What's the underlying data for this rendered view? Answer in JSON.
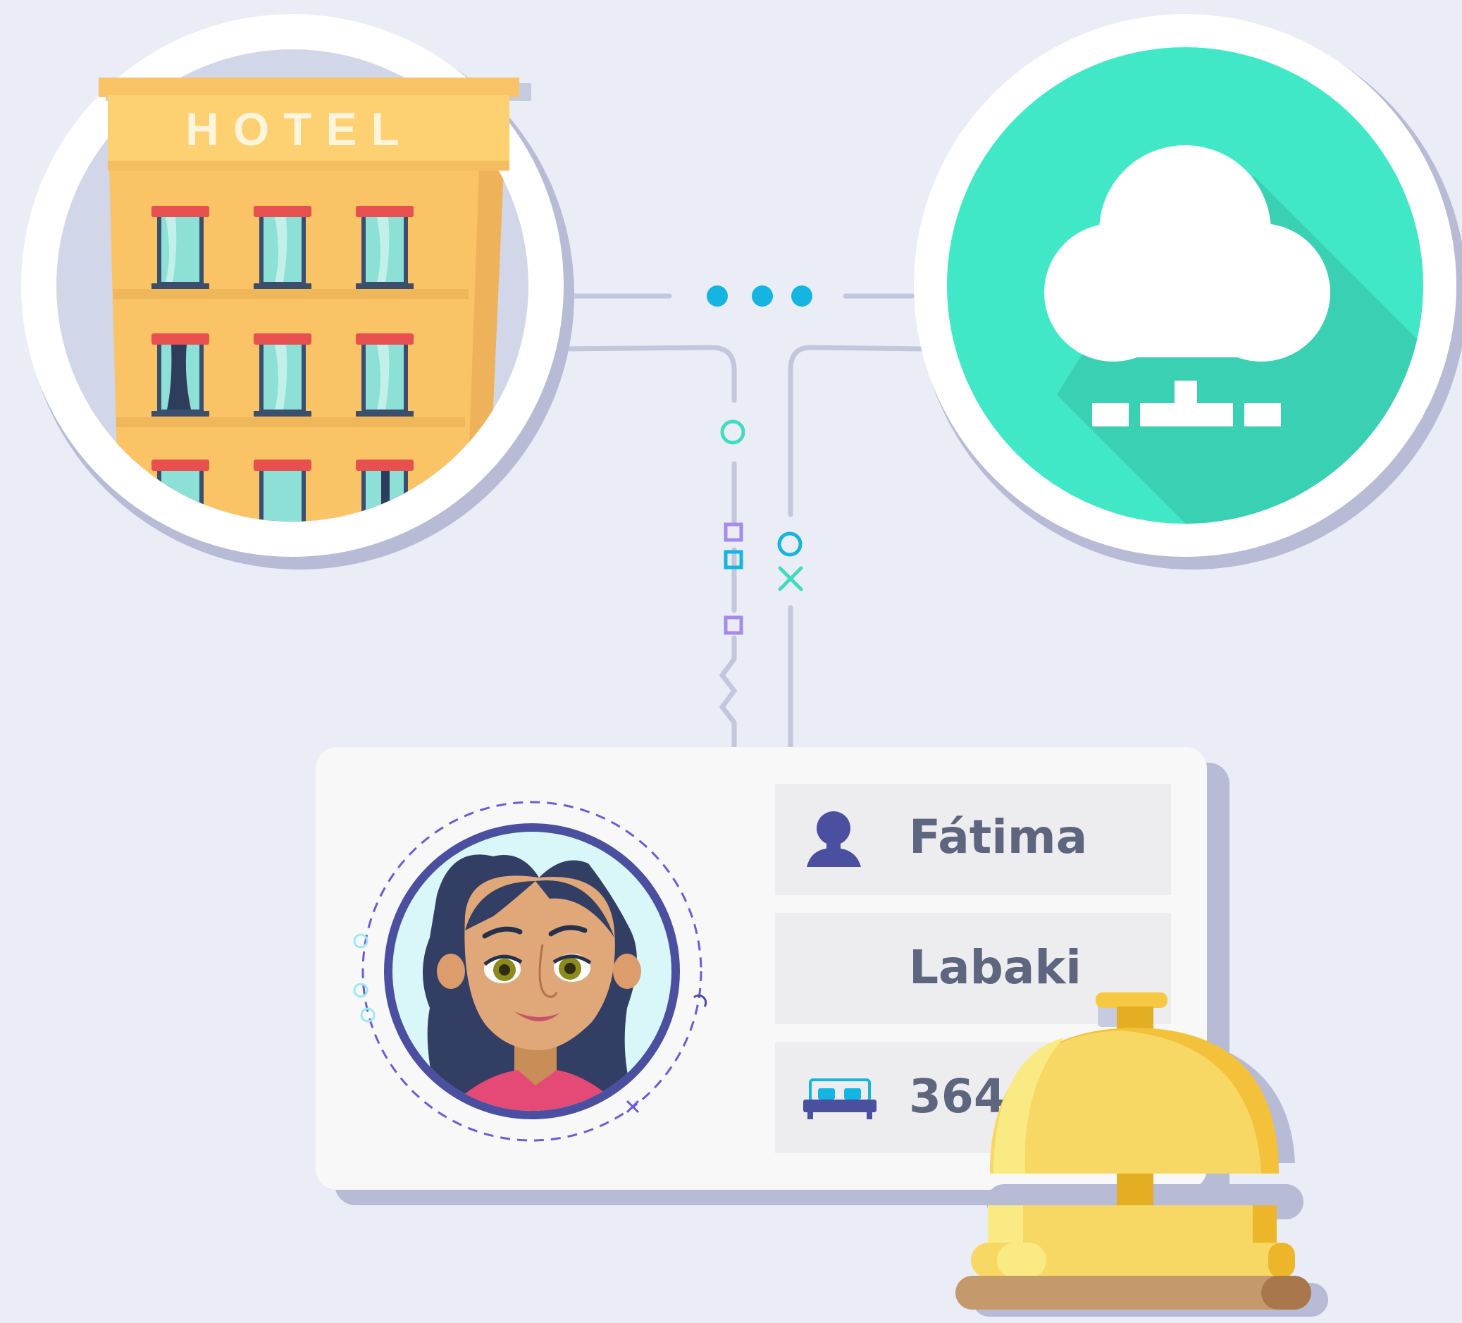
{
  "hotel": {
    "sign": "HOTEL"
  },
  "guest_card": {
    "first_name": "Fátima",
    "last_name": "Labaki",
    "room_number": "364"
  },
  "icons": {
    "hotel": "hotel-building-icon",
    "cloud": "cloud-network-icon",
    "person": "person-icon",
    "bed": "bed-icon",
    "bell": "service-bell-icon",
    "avatar": "guest-avatar"
  },
  "colors": {
    "background": "#eaedf6",
    "cloud_circle": "#41e8c8",
    "hotel_body": "#fac365",
    "text": "#5e657e",
    "accent_purple": "#4b4fa0",
    "bell_gold": "#f5c842"
  }
}
